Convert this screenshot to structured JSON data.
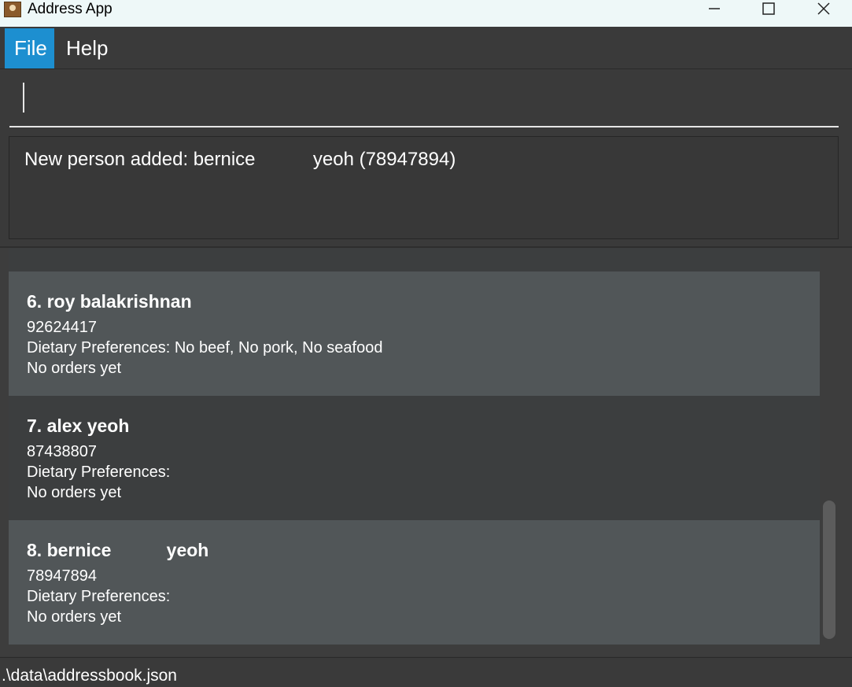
{
  "window": {
    "title": "Address App"
  },
  "menu": {
    "file": "File",
    "help": "Help"
  },
  "command": {
    "value": ""
  },
  "result": {
    "text": "New person added: bernice           yeoh (78947894)"
  },
  "persons": [
    {
      "index_name": "6. roy balakrishnan",
      "phone": "92624417",
      "dietary": "Dietary Preferences: No beef, No pork, No seafood",
      "orders": "No orders yet"
    },
    {
      "index_name": "7. alex yeoh",
      "phone": "87438807",
      "dietary": "Dietary Preferences:",
      "orders": "No orders yet"
    },
    {
      "index_name": "8. bernice           yeoh",
      "phone": "78947894",
      "dietary": "Dietary Preferences:",
      "orders": "No orders yet"
    }
  ],
  "status": {
    "path": ".\\data\\addressbook.json"
  },
  "colors": {
    "accent": "#1d8fd0",
    "card_odd": "#515658",
    "card_even": "#3c3e3f"
  }
}
